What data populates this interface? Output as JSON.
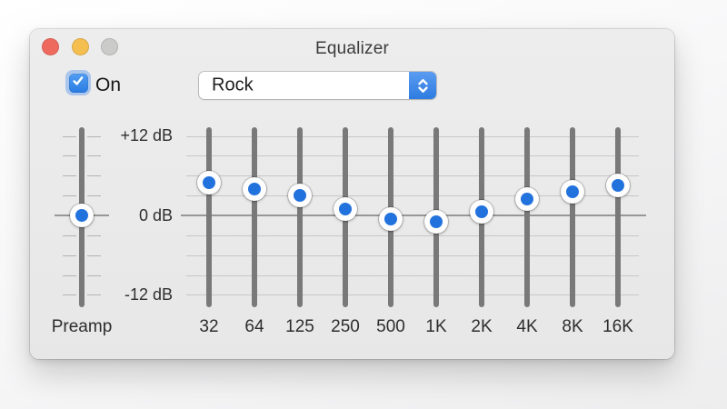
{
  "window": {
    "title": "Equalizer",
    "traffic_lights": [
      {
        "name": "close",
        "color": "#ee6a5f"
      },
      {
        "name": "minimize",
        "color": "#f5bf4f"
      },
      {
        "name": "zoom",
        "color": "#cbcbc9"
      }
    ]
  },
  "controls": {
    "on_checkbox": {
      "label": "On",
      "checked": true,
      "check_icon": "checkmark-icon"
    },
    "preset_dropdown": {
      "value": "Rock",
      "stepper_icon": "up-down-chevrons-icon"
    }
  },
  "equalizer": {
    "axis": {
      "top": "+12 dB",
      "middle": "0 dB",
      "bottom": "-12 dB",
      "range_db": [
        -12,
        12
      ],
      "tick_step_db": 3,
      "grid": true
    },
    "preamp": {
      "label": "Preamp",
      "value_db": 0
    },
    "bands": [
      {
        "label": "32",
        "value_db": 5.0
      },
      {
        "label": "64",
        "value_db": 4.0
      },
      {
        "label": "125",
        "value_db": 3.0
      },
      {
        "label": "250",
        "value_db": 1.0
      },
      {
        "label": "500",
        "value_db": -0.5
      },
      {
        "label": "1K",
        "value_db": -1.0
      },
      {
        "label": "2K",
        "value_db": 0.5
      },
      {
        "label": "4K",
        "value_db": 2.5
      },
      {
        "label": "8K",
        "value_db": 3.5
      },
      {
        "label": "16K",
        "value_db": 4.5
      }
    ]
  },
  "colors": {
    "accent_blue": "#3b7fe3",
    "knob_blue": "#2272de",
    "traffic_red": "#ee6a5f",
    "traffic_yellow": "#f5bf4f",
    "traffic_gray": "#cbcbc9"
  }
}
